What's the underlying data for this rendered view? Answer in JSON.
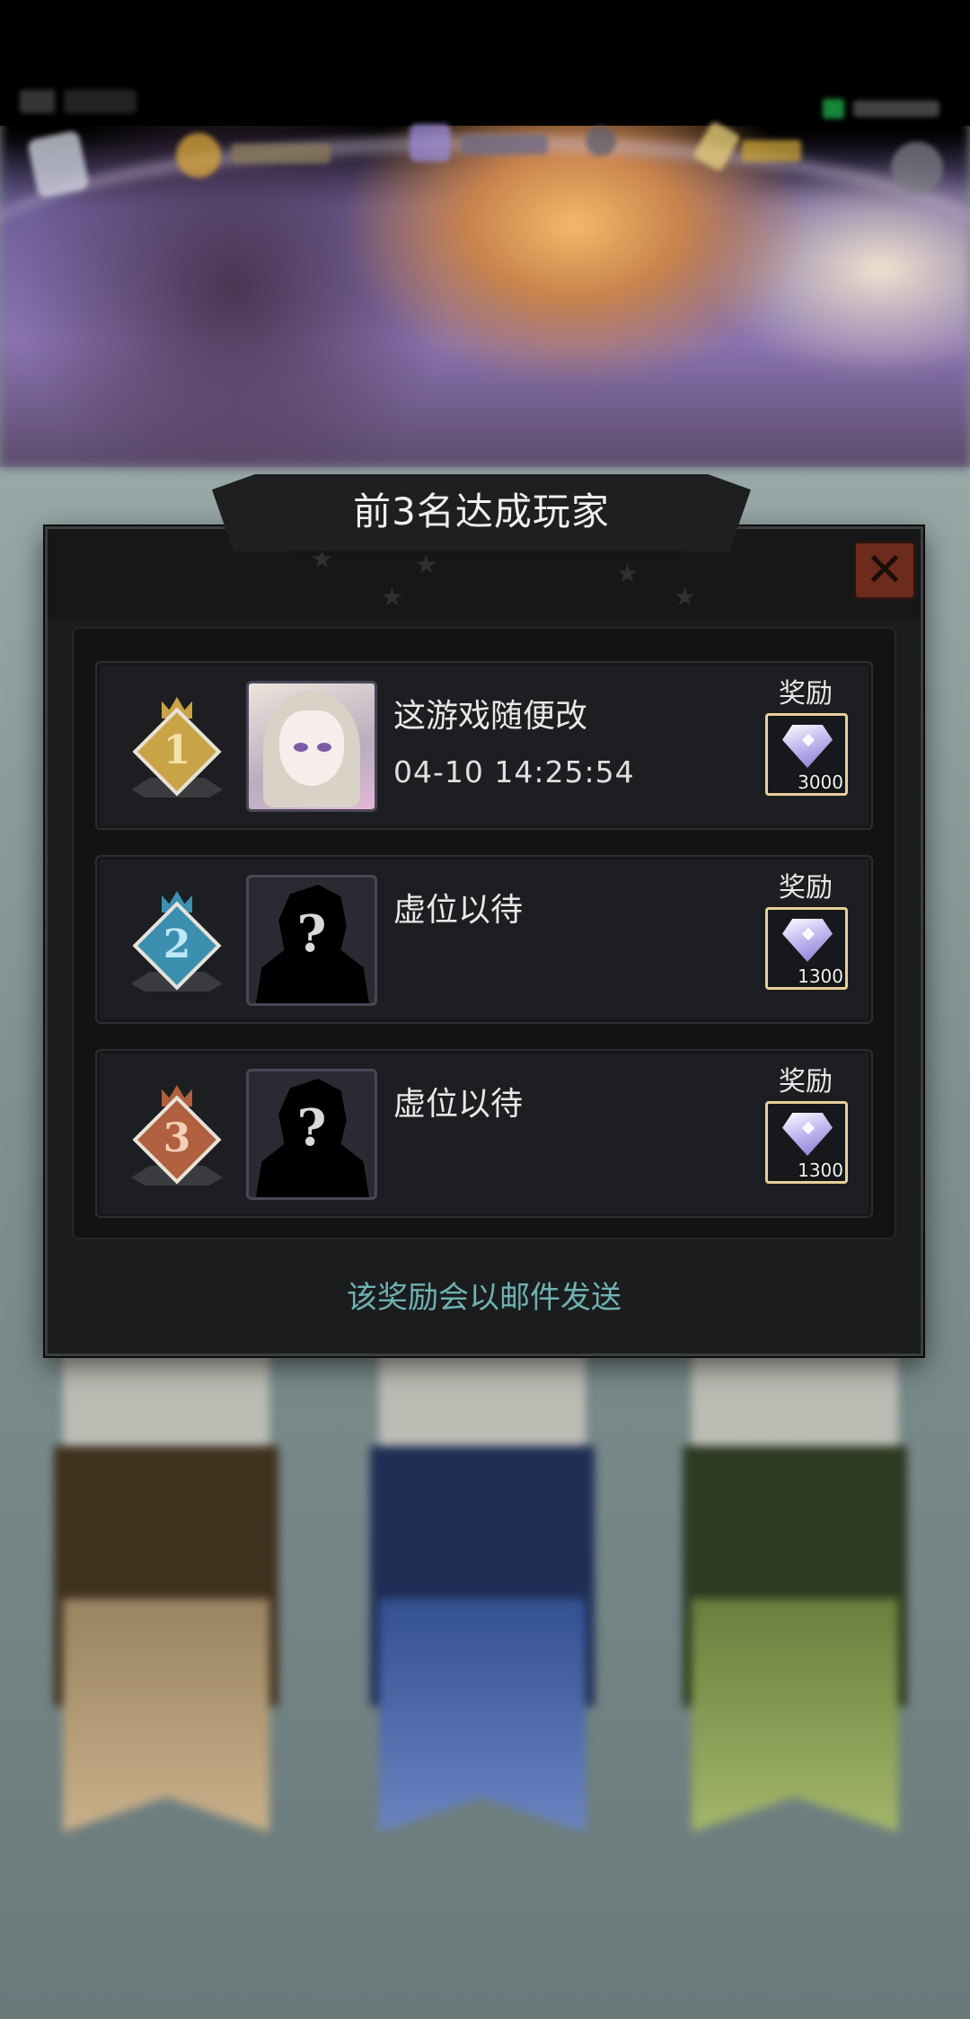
{
  "title": "前3名达成玩家",
  "footer_note": "该奖励会以邮件发送",
  "ranks": [
    {
      "rank": "1",
      "player_name": "这游戏随便改",
      "time": "04-10   14:25:54",
      "reward_label": "奖励",
      "reward_qty": "3000",
      "medal_color": "#c9a446",
      "num_color": "#f4e3a6"
    },
    {
      "rank": "2",
      "player_name": "虚位以待",
      "time": "",
      "reward_label": "奖励",
      "reward_qty": "1300",
      "medal_color": "#3d8fb0",
      "num_color": "#bde9f6"
    },
    {
      "rank": "3",
      "player_name": "虚位以待",
      "time": "",
      "reward_label": "奖励",
      "reward_qty": "1300",
      "medal_color": "#b0603e",
      "num_color": "#f6d0b6"
    }
  ],
  "icons": {
    "close": "close-icon",
    "reward": "diamond-icon",
    "mystery_avatar": "question-mark-icon"
  }
}
